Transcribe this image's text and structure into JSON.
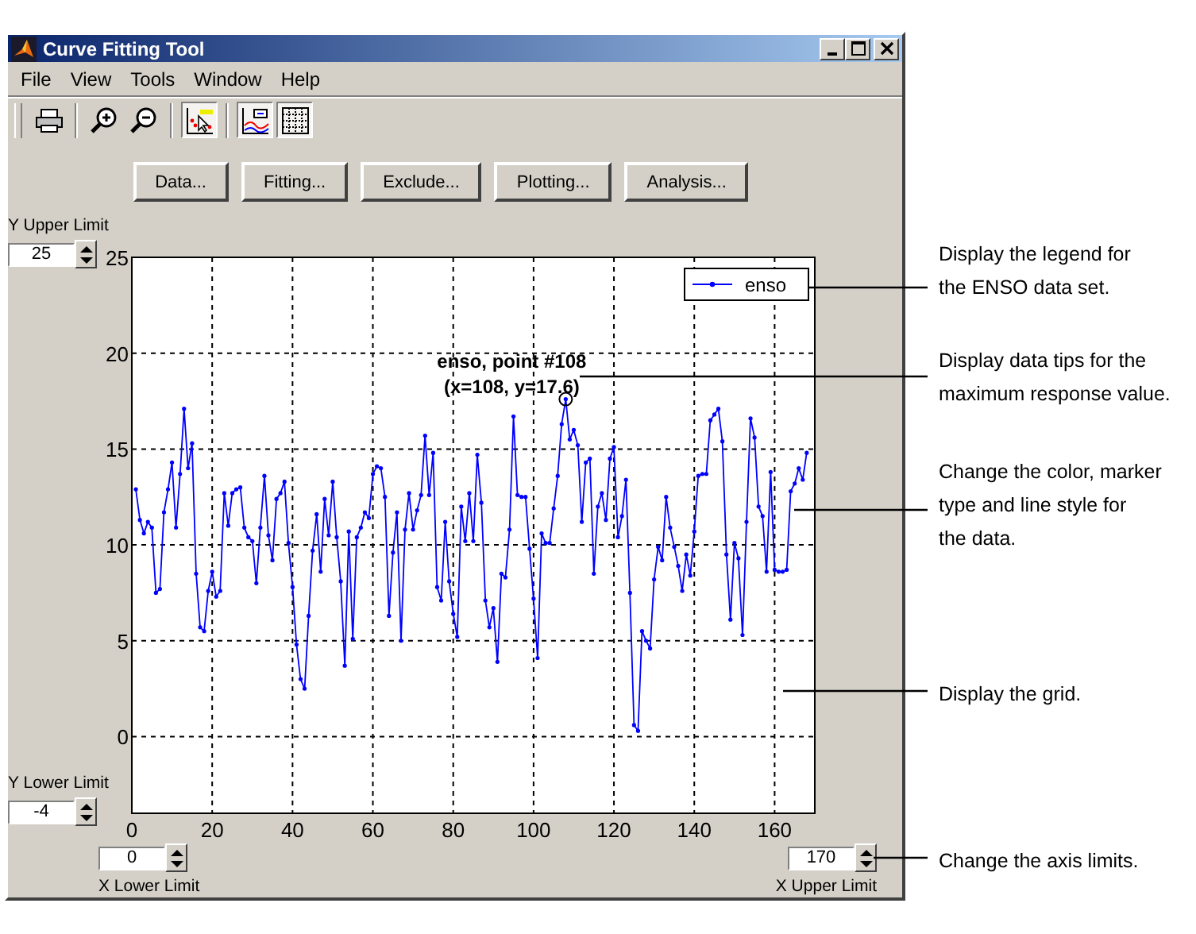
{
  "window": {
    "title": "Curve Fitting Tool"
  },
  "menu": [
    "File",
    "View",
    "Tools",
    "Window",
    "Help"
  ],
  "toolbar": [
    {
      "kind": "print",
      "on": false
    },
    {
      "kind": "zoom_in",
      "on": false
    },
    {
      "kind": "zoom_out",
      "on": false
    },
    {
      "kind": "data_cursor",
      "on": true
    },
    {
      "kind": "legend",
      "on": true
    },
    {
      "kind": "grid",
      "on": true
    }
  ],
  "buttons": [
    "Data...",
    "Fitting...",
    "Exclude...",
    "Plotting...",
    "Analysis..."
  ],
  "limits": {
    "y_upper": {
      "label": "Y Upper Limit",
      "value": "25"
    },
    "y_lower": {
      "label": "Y Lower Limit",
      "value": "-4"
    },
    "x_lower": {
      "label": "X Lower Limit",
      "value": "0"
    },
    "x_upper": {
      "label": "X Upper Limit",
      "value": "170"
    }
  },
  "plot": {
    "datatip": {
      "line_1": "enso, point #108",
      "line_2": "(x=108, y=17.6)"
    },
    "chart_data": {
      "type": "line",
      "grid": true,
      "xlim": [
        0,
        170
      ],
      "ylim": [
        -4,
        25
      ],
      "xticks": [
        0,
        20,
        40,
        60,
        80,
        100,
        120,
        140,
        160
      ],
      "yticks": [
        0,
        5,
        10,
        15,
        20,
        25
      ],
      "x": [
        1,
        2,
        3,
        4,
        5,
        6,
        7,
        8,
        9,
        10,
        11,
        12,
        13,
        14,
        15,
        16,
        17,
        18,
        19,
        20,
        21,
        22,
        23,
        24,
        25,
        26,
        27,
        28,
        29,
        30,
        31,
        32,
        33,
        34,
        35,
        36,
        37,
        38,
        39,
        40,
        41,
        42,
        43,
        44,
        45,
        46,
        47,
        48,
        49,
        50,
        51,
        52,
        53,
        54,
        55,
        56,
        57,
        58,
        59,
        60,
        61,
        62,
        63,
        64,
        65,
        66,
        67,
        68,
        69,
        70,
        71,
        72,
        73,
        74,
        75,
        76,
        77,
        78,
        79,
        80,
        81,
        82,
        83,
        84,
        85,
        86,
        87,
        88,
        89,
        90,
        91,
        92,
        93,
        94,
        95,
        96,
        97,
        98,
        99,
        100,
        101,
        102,
        103,
        104,
        105,
        106,
        107,
        108,
        109,
        110,
        111,
        112,
        113,
        114,
        115,
        116,
        117,
        118,
        119,
        120,
        121,
        122,
        123,
        124,
        125,
        126,
        127,
        128,
        129,
        130,
        131,
        132,
        133,
        134,
        135,
        136,
        137,
        138,
        139,
        140,
        141,
        142,
        143,
        144,
        145,
        146,
        147,
        148,
        149,
        150,
        151,
        152,
        153,
        154,
        155,
        156,
        157,
        158,
        159,
        160,
        161,
        162,
        163,
        164,
        165,
        166,
        167,
        168
      ],
      "series": [
        {
          "name": "enso",
          "color": "#0000ff",
          "values": [
            12.9,
            11.3,
            10.6,
            11.2,
            10.9,
            7.5,
            7.7,
            11.7,
            12.9,
            14.3,
            10.9,
            13.7,
            17.1,
            14.0,
            15.3,
            8.5,
            5.7,
            5.5,
            7.6,
            8.6,
            7.3,
            7.6,
            12.7,
            11.0,
            12.7,
            12.9,
            13.0,
            10.9,
            10.4,
            10.2,
            8.0,
            10.9,
            13.6,
            10.5,
            9.2,
            12.4,
            12.7,
            13.3,
            10.1,
            7.8,
            4.8,
            3.0,
            2.5,
            6.3,
            9.7,
            11.6,
            8.6,
            12.4,
            10.5,
            13.3,
            10.4,
            8.1,
            3.7,
            10.7,
            5.1,
            10.4,
            10.9,
            11.7,
            11.4,
            13.7,
            14.1,
            14.0,
            12.5,
            6.3,
            9.6,
            11.7,
            5.0,
            10.8,
            12.7,
            10.8,
            11.8,
            12.6,
            15.7,
            12.6,
            14.8,
            7.8,
            7.1,
            11.2,
            8.1,
            6.4,
            5.2,
            12.0,
            10.2,
            12.7,
            10.2,
            14.7,
            12.2,
            7.1,
            5.7,
            6.7,
            3.9,
            8.5,
            8.3,
            10.8,
            16.7,
            12.6,
            12.5,
            12.5,
            9.8,
            7.2,
            4.1,
            10.6,
            10.1,
            10.1,
            11.9,
            13.6,
            16.3,
            17.6,
            15.5,
            16.0,
            15.2,
            11.2,
            14.3,
            14.5,
            8.5,
            12.0,
            12.7,
            11.3,
            14.5,
            15.1,
            10.4,
            11.5,
            13.4,
            7.5,
            0.6,
            0.3,
            5.5,
            5.0,
            4.6,
            8.2,
            9.9,
            9.2,
            12.5,
            10.9,
            9.9,
            8.9,
            7.6,
            9.5,
            8.4,
            10.7,
            13.6,
            13.7,
            13.7,
            16.5,
            16.8,
            17.1,
            15.4,
            9.5,
            6.1,
            10.1,
            9.3,
            5.3,
            11.2,
            16.6,
            15.6,
            12.0,
            11.5,
            8.6,
            13.8,
            8.7,
            8.6,
            8.6,
            8.7,
            12.8,
            13.2,
            14.0,
            13.4,
            14.8
          ]
        }
      ]
    }
  },
  "callouts": [
    {
      "lines": [
        "Display the legend for",
        "the ENSO data set."
      ]
    },
    {
      "lines": [
        "Display data tips for the",
        "maximum response value."
      ]
    },
    {
      "lines": [
        "Change the color, marker",
        "type and line style for",
        "the data."
      ]
    },
    {
      "lines": [
        "Display the grid."
      ]
    },
    {
      "lines": [
        "Change the axis limits."
      ]
    }
  ]
}
